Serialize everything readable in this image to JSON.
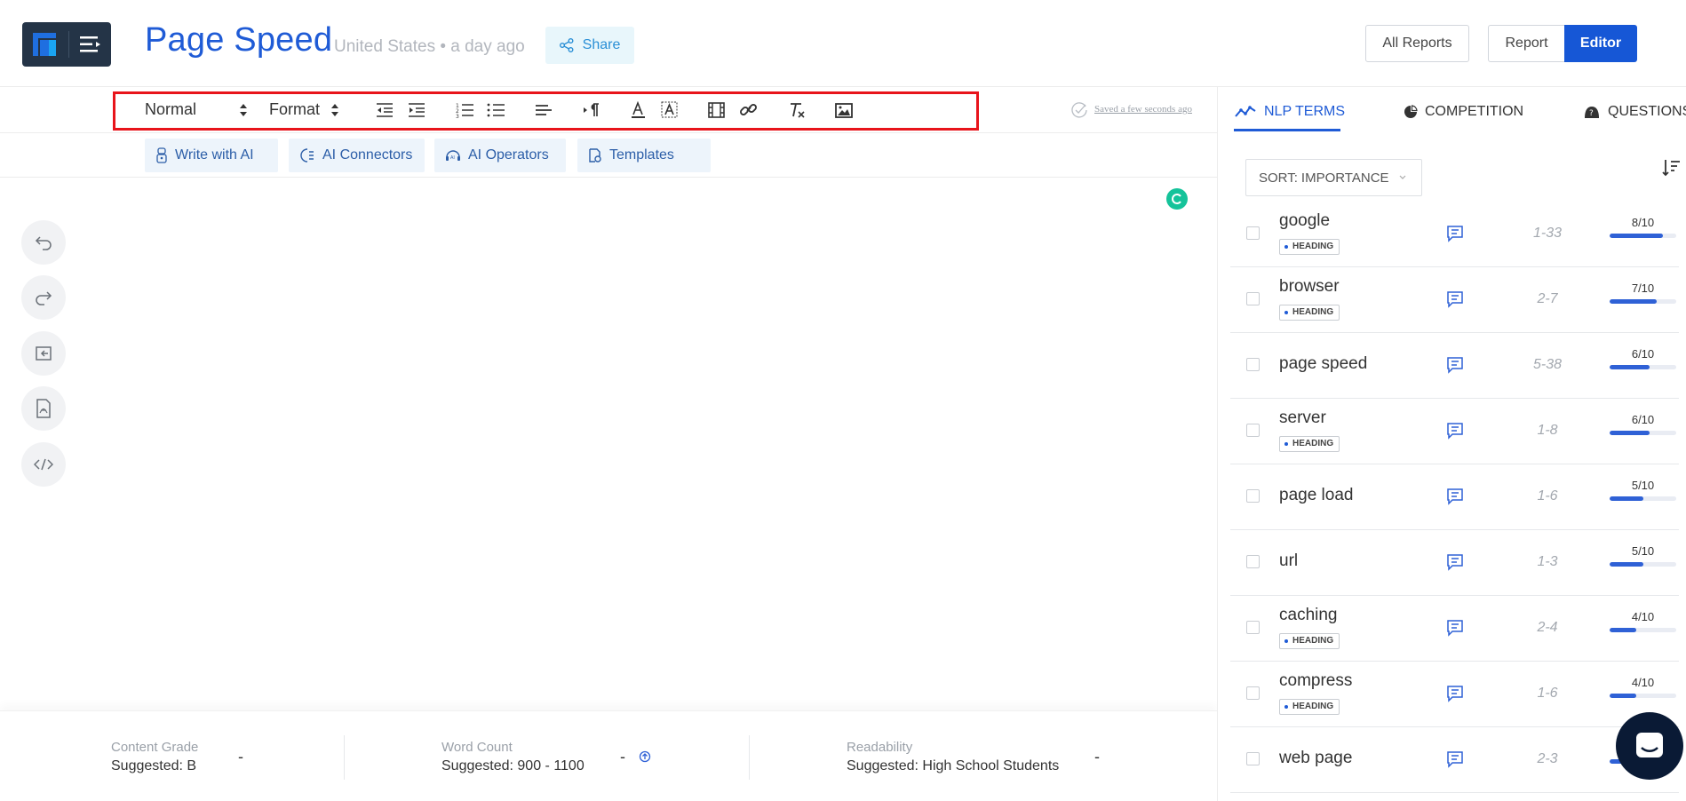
{
  "header": {
    "title": "Page Speed",
    "meta": "United States • a day ago",
    "share_label": "Share",
    "all_reports_label": "All Reports",
    "report_label": "Report",
    "editor_label": "Editor",
    "brand_color": "#1657d6"
  },
  "toolbar": {
    "style_select": "Normal",
    "format_select": "Format",
    "icons": [
      "outdent-icon",
      "indent-icon",
      "ordered-list-icon",
      "bullet-list-icon",
      "align-icon",
      "paragraph-direction-icon",
      "text-color-icon",
      "highlight-color-icon",
      "video-icon",
      "link-icon",
      "clear-format-icon",
      "image-icon"
    ],
    "saved_text": "Saved a few seconds ago"
  },
  "ai_buttons": [
    {
      "label": "Write with AI"
    },
    {
      "label": "AI Connectors"
    },
    {
      "label": "AI Operators"
    },
    {
      "label": "Templates"
    }
  ],
  "side_buttons": [
    "undo-icon",
    "redo-icon",
    "export-icon",
    "pdf-icon",
    "code-icon"
  ],
  "footer": {
    "content_grade": {
      "label": "Content Grade",
      "suggested": "Suggested: B",
      "value": "-"
    },
    "word_count": {
      "label": "Word Count",
      "suggested": "Suggested: 900 - 1100",
      "value": "-"
    },
    "readability": {
      "label": "Readability",
      "suggested": "Suggested: High School Students",
      "value": "-"
    }
  },
  "panel": {
    "tabs": [
      {
        "label": "NLP TERMS",
        "active": true
      },
      {
        "label": "COMPETITION",
        "active": false
      },
      {
        "label": "QUESTIONS",
        "active": false
      }
    ],
    "sort_label": "SORT:",
    "sort_value": "IMPORTANCE",
    "terms": [
      {
        "name": "google",
        "badge": "HEADING",
        "range": "1-33",
        "score": "8/10",
        "fraction": 0.8
      },
      {
        "name": "browser",
        "badge": "HEADING",
        "range": "2-7",
        "score": "7/10",
        "fraction": 0.7
      },
      {
        "name": "page speed",
        "badge": "",
        "range": "5-38",
        "score": "6/10",
        "fraction": 0.6
      },
      {
        "name": "server",
        "badge": "HEADING",
        "range": "1-8",
        "score": "6/10",
        "fraction": 0.6
      },
      {
        "name": "page load",
        "badge": "",
        "range": "1-6",
        "score": "5/10",
        "fraction": 0.5
      },
      {
        "name": "url",
        "badge": "",
        "range": "1-3",
        "score": "5/10",
        "fraction": 0.5
      },
      {
        "name": "caching",
        "badge": "HEADING",
        "range": "2-4",
        "score": "4/10",
        "fraction": 0.4
      },
      {
        "name": "compress",
        "badge": "HEADING",
        "range": "1-6",
        "score": "4/10",
        "fraction": 0.4
      },
      {
        "name": "web page",
        "badge": "",
        "range": "2-3",
        "score": "",
        "fraction": 0.4
      }
    ]
  }
}
